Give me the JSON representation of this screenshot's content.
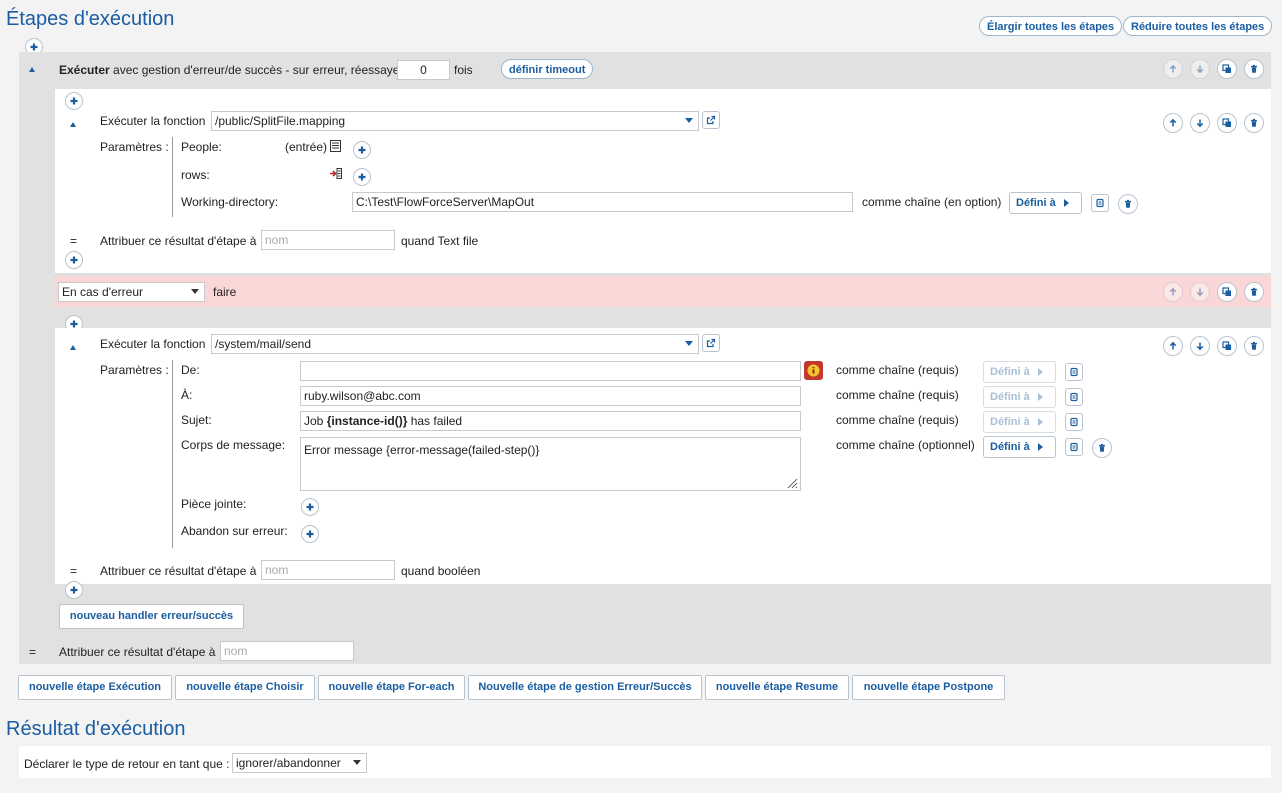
{
  "title": "Étapes d'exécution",
  "expand_all": "Élargir toutes les étapes",
  "collapse_all": "Réduire toutes les étapes",
  "exec_block": {
    "exec_bold": "Exécuter",
    "exec_rest": "avec gestion d'erreur/de succès - sur erreur, réessayer",
    "retry_value": "0",
    "times": "fois",
    "timeout_button": "définir timeout"
  },
  "step1": {
    "label": "Exécuter la fonction",
    "function_path": "/public/SplitFile.mapping",
    "params_label": "Paramètres :",
    "params": [
      {
        "name": "People:",
        "hint": "(entrée)"
      },
      {
        "name": "rows:"
      },
      {
        "name": "Working-directory:",
        "value": "C:\\Test\\FlowForceServer\\MapOut",
        "type": "comme chaîne (en option)",
        "set_btn": "Défini à"
      }
    ],
    "assign_eq": "=",
    "assign_label": "Attribuer ce résultat d'étape à",
    "assign_placeholder": "nom",
    "assign_when": "quand Text file"
  },
  "handler": {
    "condition": "En cas d'erreur",
    "do": "faire"
  },
  "step2": {
    "label": "Exécuter la fonction",
    "function_path": "/system/mail/send",
    "params_label": "Paramètres :",
    "params": [
      {
        "name": "De:",
        "value": "",
        "type": "comme chaîne (requis)",
        "set_btn": "Défini à"
      },
      {
        "name": "À:",
        "value": "ruby.wilson@abc.com",
        "type": "comme chaîne (requis)",
        "set_btn": "Défini à"
      },
      {
        "name": "Sujet:",
        "value_pre": "Job ",
        "value_bold": "{instance-id()}",
        "value_post": " has failed",
        "type": "comme chaîne (requis)",
        "set_btn": "Défini à"
      },
      {
        "name": "Corps de message:",
        "value": "Error message {error-message(failed-step()}",
        "type": "comme chaîne (optionnel)",
        "set_btn": "Défini à"
      },
      {
        "name": "Pièce jointe:"
      },
      {
        "name": "Abandon sur erreur:"
      }
    ],
    "assign_eq": "=",
    "assign_label": "Attribuer ce résultat d'étape à",
    "assign_placeholder": "nom",
    "assign_when": "quand booléen"
  },
  "new_handler_button": "nouveau handler erreur/succès",
  "outer_assign": {
    "eq": "=",
    "label": "Attribuer ce résultat d'étape à",
    "placeholder": "nom"
  },
  "bottom_buttons": [
    "nouvelle étape Exécution",
    "nouvelle étape Choisir",
    "nouvelle étape For-each",
    "Nouvelle étape de gestion Erreur/Succès",
    "nouvelle étape Resume",
    "nouvelle étape Postpone"
  ],
  "result": {
    "title": "Résultat d'exécution",
    "label": "Déclarer le type de retour en tant que :",
    "value": "ignorer/abandonner"
  }
}
